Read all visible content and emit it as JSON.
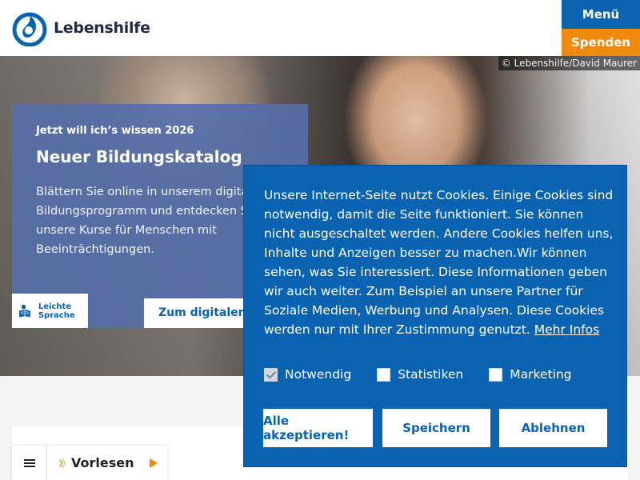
{
  "header": {
    "logo_text": "Lebenshilfe",
    "menu_label": "Menü",
    "donate_label": "Spenden"
  },
  "hero": {
    "credit": "© Lebenshilfe/David Maurer",
    "kicker": "Jetzt will ich’s wissen 2026",
    "title": "Neuer Bildungskatalog",
    "text": "Blättern Sie online in unserem digitalen Bildungsprogramm und entdecken Sie unsere Kurse für Menschen mit Beeinträchtigungen.",
    "easy_language_label": "Leichte Sprache",
    "catalog_button": "Zum digitalen P"
  },
  "reader": {
    "label": "Vorlesen"
  },
  "cookie_banner": {
    "text": "Unsere Internet-Seite nutzt Cookies. Einige Cookies sind notwendig, damit die Seite funktioniert. Sie können nicht ausgeschaltet werden. Andere Cookies helfen uns, Inhalte und Anzeigen besser zu machen.Wir können sehen, was Sie interessiert. Diese Informationen geben wir auch weiter. Zum Beispiel an unsere Partner für Soziale Medien, Werbung und Analysen. Diese Cookies werden nur mit Ihrer Zustimmung genutzt.",
    "more_link": "Mehr Infos",
    "options": [
      {
        "label": "Notwendig",
        "checked": true,
        "disabled": true
      },
      {
        "label": "Statistiken",
        "checked": false
      },
      {
        "label": "Marketing",
        "checked": false
      }
    ],
    "accept_label": "Alle akzeptieren!",
    "save_label": "Speichern",
    "reject_label": "Ablehnen"
  },
  "colors": {
    "brand_blue": "#0a63b1",
    "donate_orange": "#f08a0f",
    "promo_blue": "#546eaa"
  }
}
